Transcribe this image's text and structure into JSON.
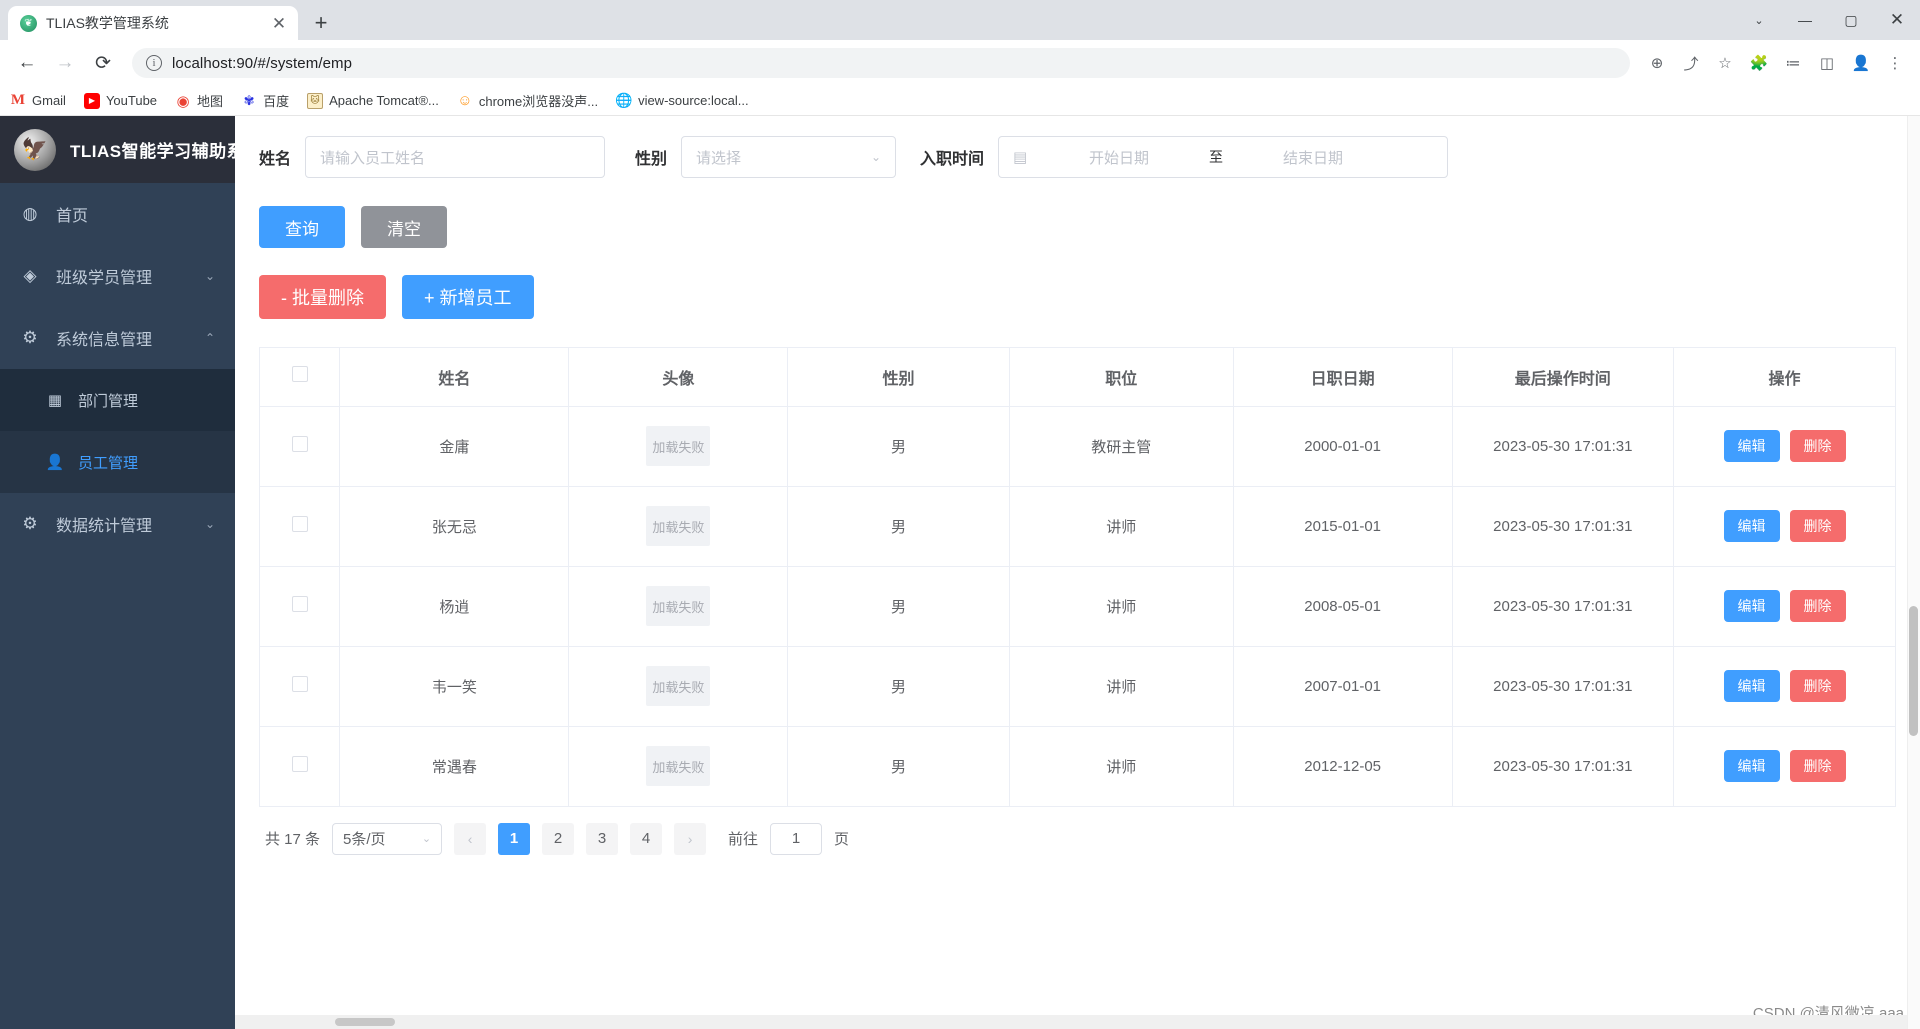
{
  "browser": {
    "tab": {
      "title": "TLIAS教学管理系统",
      "close_label": "✕",
      "favicon": "leaf-favicon"
    },
    "newtab_label": "+",
    "window": {
      "minimize": "—",
      "maximize": "▢",
      "close": "✕",
      "chevron": "⌄"
    },
    "nav": {
      "back": "←",
      "forward": "→",
      "reload": "⟳"
    },
    "omnibox": {
      "info_icon": "ⓘ",
      "url": "localhost:90/#/system/emp"
    },
    "toolbar_icons": [
      "zoom-icon",
      "share-icon",
      "star-icon",
      "extensions-icon",
      "reading-list-icon",
      "side-panel-icon",
      "profile-icon",
      "menu-icon"
    ],
    "bookmarks": [
      {
        "label": "Gmail",
        "icon": "gmail-icon",
        "glyph": "M"
      },
      {
        "label": "YouTube",
        "icon": "youtube-icon",
        "glyph": "▶"
      },
      {
        "label": "地图",
        "icon": "maps-icon",
        "glyph": "◉"
      },
      {
        "label": "百度",
        "icon": "baidu-icon",
        "glyph": "🐾"
      },
      {
        "label": "Apache Tomcat®...",
        "icon": "tomcat-icon",
        "glyph": "🐱"
      },
      {
        "label": "chrome浏览器没声...",
        "icon": "orange-circle-icon",
        "glyph": "☺"
      },
      {
        "label": "view-source:local...",
        "icon": "globe-icon",
        "glyph": "🌐"
      }
    ]
  },
  "sidebar": {
    "brand": {
      "title": "TLIAS智能学习辅助系统",
      "logo": "tlias-logo"
    },
    "items": [
      {
        "label": "首页",
        "icon": "dashboard-icon",
        "glyph": "◍",
        "chevron": ""
      },
      {
        "label": "班级学员管理",
        "icon": "class-icon",
        "glyph": "◈",
        "chevron": "⌄"
      },
      {
        "label": "系统信息管理",
        "icon": "gear-icon",
        "glyph": "⚙",
        "chevron": "⌃"
      },
      {
        "label": "数据统计管理",
        "icon": "gear-icon",
        "glyph": "⚙",
        "chevron": "⌄"
      }
    ],
    "submenu": [
      {
        "label": "部门管理",
        "icon": "grid-icon",
        "glyph": "▦",
        "active": false
      },
      {
        "label": "员工管理",
        "icon": "user-icon",
        "glyph": "👤",
        "active": true
      }
    ]
  },
  "search_form": {
    "name_label": "姓名",
    "name_placeholder": "请输入员工姓名",
    "gender_label": "性别",
    "gender_placeholder": "请选择",
    "gender_caret": "⌄",
    "date_label": "入职时间",
    "calendar_icon": "calendar-icon",
    "date_start_placeholder": "开始日期",
    "date_separator": "至",
    "date_end_placeholder": "结束日期"
  },
  "actions": {
    "search": "查询",
    "clear": "清空",
    "batch_delete": "- 批量删除",
    "add_employee": "+ 新增员工"
  },
  "table": {
    "columns": [
      "",
      "姓名",
      "头像",
      "性别",
      "职位",
      "日职日期",
      "最后操作时间",
      "操作"
    ],
    "row_buttons": {
      "edit": "编辑",
      "delete": "删除"
    },
    "avatar_placeholder": "加载失败",
    "rows": [
      {
        "name": "金庸",
        "avatar": "加载失败",
        "gender": "男",
        "position": "教研主管",
        "hire_date": "2000-01-01",
        "updated": "2023-05-30 17:01:31"
      },
      {
        "name": "张无忌",
        "avatar": "加载失败",
        "gender": "男",
        "position": "讲师",
        "hire_date": "2015-01-01",
        "updated": "2023-05-30 17:01:31"
      },
      {
        "name": "杨逍",
        "avatar": "加载失败",
        "gender": "男",
        "position": "讲师",
        "hire_date": "2008-05-01",
        "updated": "2023-05-30 17:01:31"
      },
      {
        "name": "韦一笑",
        "avatar": "加载失败",
        "gender": "男",
        "position": "讲师",
        "hire_date": "2007-01-01",
        "updated": "2023-05-30 17:01:31"
      },
      {
        "name": "常遇春",
        "avatar": "加载失败",
        "gender": "男",
        "position": "讲师",
        "hire_date": "2012-12-05",
        "updated": "2023-05-30 17:01:31"
      }
    ]
  },
  "pagination": {
    "total": "共 17 条",
    "page_size": "5条/页",
    "caret": "⌄",
    "prev": "‹",
    "next": "›",
    "pages": [
      "1",
      "2",
      "3",
      "4"
    ],
    "active_page": "1",
    "jump_prefix": "前往",
    "jump_value": "1",
    "jump_suffix": "页"
  },
  "watermark": "CSDN @清风微凉 aaa"
}
